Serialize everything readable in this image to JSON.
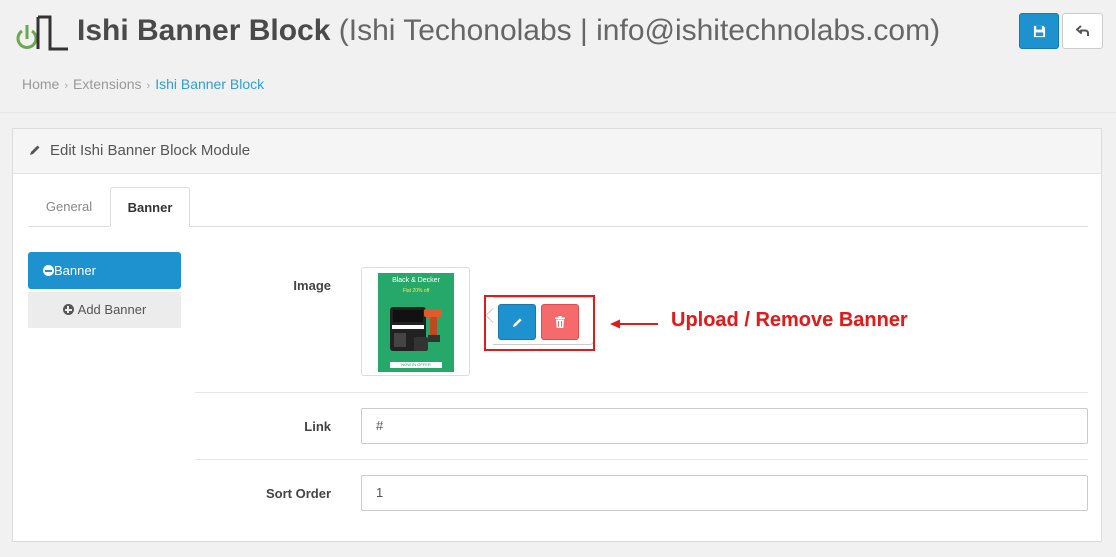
{
  "header": {
    "app_name": "Ishi Banner Block",
    "subtitle": "(Ishi Techonolabs | info@ishitechnolabs.com)",
    "save_icon": "save-icon",
    "back_icon": "reply-icon"
  },
  "breadcrumb": [
    "Home",
    "Extensions",
    "Ishi Banner Block"
  ],
  "panel": {
    "title": "Edit Ishi Banner Block Module",
    "title_icon": "pencil-icon"
  },
  "tabs": [
    {
      "label": "General",
      "active": false
    },
    {
      "label": "Banner",
      "active": true
    }
  ],
  "sidebar": {
    "active_item": "Banner",
    "add_button": "Add Banner"
  },
  "form": {
    "image_label": "Image",
    "banner_image": {
      "title": "Black & Decker",
      "subtitle": "Flat 20% off",
      "footer": "NOW IN OFFER"
    },
    "link_label": "Link",
    "link_value": "#",
    "sort_order_label": "Sort Order",
    "sort_order_value": "1"
  },
  "annotation": {
    "text": "Upload / Remove Banner",
    "color": "#e01b1b"
  },
  "colors": {
    "primary": "#1e91cf",
    "danger": "#f56b6b",
    "banner_green": "#27a86b"
  }
}
